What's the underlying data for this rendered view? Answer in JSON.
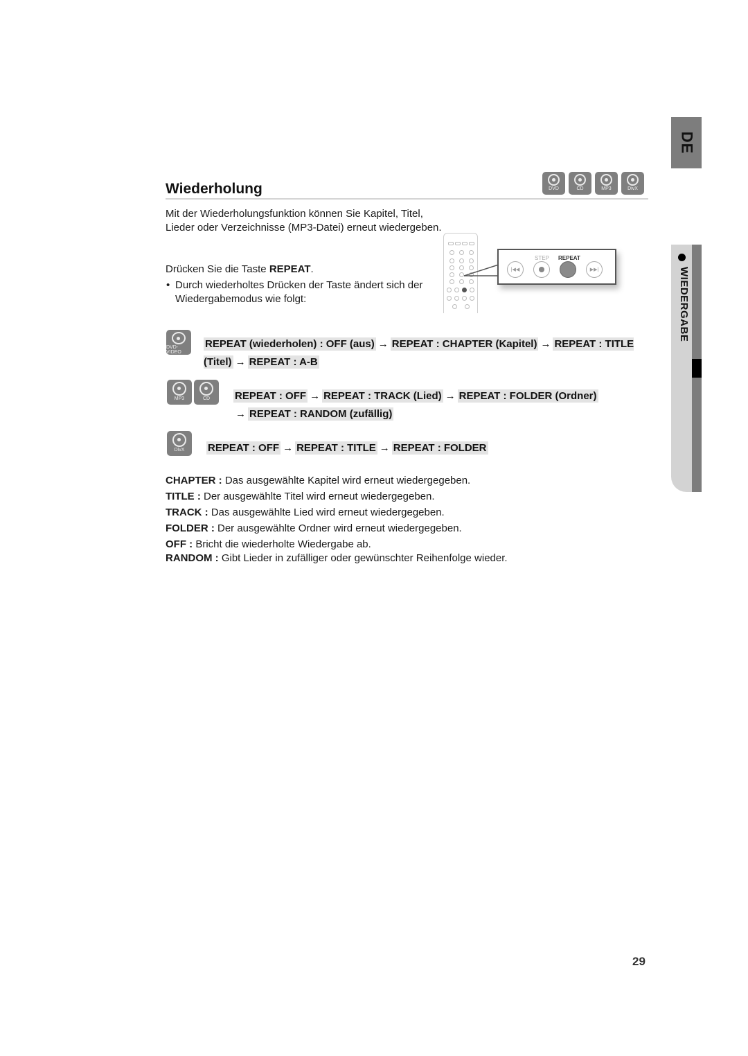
{
  "side_tabs": {
    "language": "DE",
    "chapter": "WIEDERGABE"
  },
  "header": {
    "title": "Wiederholung",
    "disc_badges": [
      {
        "icon": "disc-icon",
        "label": "DVD"
      },
      {
        "icon": "disc-icon",
        "label": "CD"
      },
      {
        "icon": "disc-icon",
        "label": "MP3"
      },
      {
        "icon": "disc-icon",
        "label": "DivX"
      }
    ]
  },
  "intro": {
    "paragraph": "Mit der Wiederholungsfunktion können Sie Kapitel, Titel, Lieder oder Verzeichnisse (MP3-Datei) erneut wiedergeben.",
    "instruction_prefix": "Drücken Sie die Taste ",
    "instruction_key": "REPEAT",
    "instruction_suffix": ".",
    "bullet": "Durch wiederholtes Drücken der Taste ändert sich der Wiedergabemodus wie folgt:"
  },
  "illustration": {
    "step_label": "STEP",
    "repeat_label": "REPEAT",
    "buttons": [
      "skip-back",
      "step",
      "repeat",
      "skip-forward"
    ]
  },
  "sequences": [
    {
      "badges": [
        "DVD-VIDEO"
      ],
      "steps": [
        "REPEAT (wiederholen) : OFF (aus)",
        "REPEAT : CHAPTER (Kapitel)",
        "REPEAT : TITLE (Titel)",
        "REPEAT : A-B"
      ]
    },
    {
      "badges": [
        "MP3",
        "CD"
      ],
      "steps": [
        "REPEAT : OFF",
        "REPEAT : TRACK (Lied)",
        "REPEAT : FOLDER (Ordner)",
        "REPEAT : RANDOM (zufällig)"
      ]
    },
    {
      "badges": [
        "DivX"
      ],
      "steps": [
        "REPEAT : OFF",
        "REPEAT : TITLE",
        "REPEAT : FOLDER"
      ]
    }
  ],
  "arrow": "→",
  "definitions": [
    {
      "term": "CHAPTER :",
      "text": " Das ausgewählte Kapitel wird erneut wiedergegeben."
    },
    {
      "term": "TITLE :",
      "text": " Der ausgewählte Titel wird erneut wiedergegeben."
    },
    {
      "term": "TRACK :",
      "text": " Das ausgewählte Lied wird erneut wiedergegeben."
    },
    {
      "term": "FOLDER :",
      "text": " Der ausgewählte Ordner wird erneut wiedergegeben."
    },
    {
      "term": "OFF :",
      "text": " Bricht die wiederholte Wiedergabe ab."
    },
    {
      "term": "RANDOM :",
      "text": " Gibt Lieder in zufälliger oder gewünschter Reihenfolge wieder."
    }
  ],
  "footer": {
    "page_number": "29"
  }
}
